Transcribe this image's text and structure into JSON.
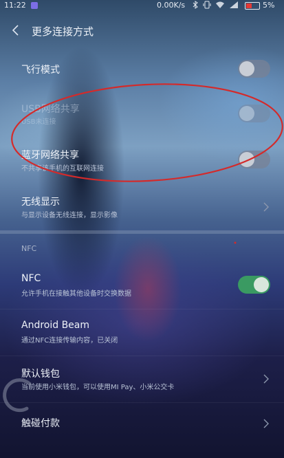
{
  "status_bar": {
    "time": "11:22",
    "network_speed": "0.00K/s",
    "battery_percent": "5%",
    "battery_color": "#e53935",
    "icons": [
      "app-notification-icon",
      "bluetooth-icon",
      "vibrate-icon",
      "wifi-icon",
      "signal-icon",
      "battery-icon"
    ]
  },
  "header": {
    "title": "更多连接方式",
    "back_icon": "chevron-left-icon"
  },
  "settings": {
    "airplane": {
      "label": "飞行模式",
      "enabled": false
    },
    "usb_tethering": {
      "label": "USB网络共享",
      "subtitle": "USB未连接",
      "enabled": false,
      "disabled": true
    },
    "bt_tethering": {
      "label": "蓝牙网络共享",
      "subtitle": "不共享该手机的互联网连接",
      "enabled": false
    },
    "wireless_display": {
      "label": "无线显示",
      "subtitle": "与显示设备无线连接，显示影像"
    }
  },
  "nfc_section": {
    "header": "NFC",
    "nfc": {
      "label": "NFC",
      "subtitle": "允许手机在接触其他设备时交换数据",
      "enabled": true
    },
    "android_beam": {
      "label": "Android Beam",
      "subtitle": "通过NFC连接传输内容，已关闭"
    },
    "default_wallet": {
      "label": "默认钱包",
      "subtitle": "当前使用小米钱包，可以使用MI Pay、小米公交卡"
    },
    "tap_pay": {
      "label": "触碰付款"
    }
  },
  "colors": {
    "toggle_on": "#3a9a62",
    "toggle_off": "#7c8294",
    "annotation": "#d42a2a"
  }
}
